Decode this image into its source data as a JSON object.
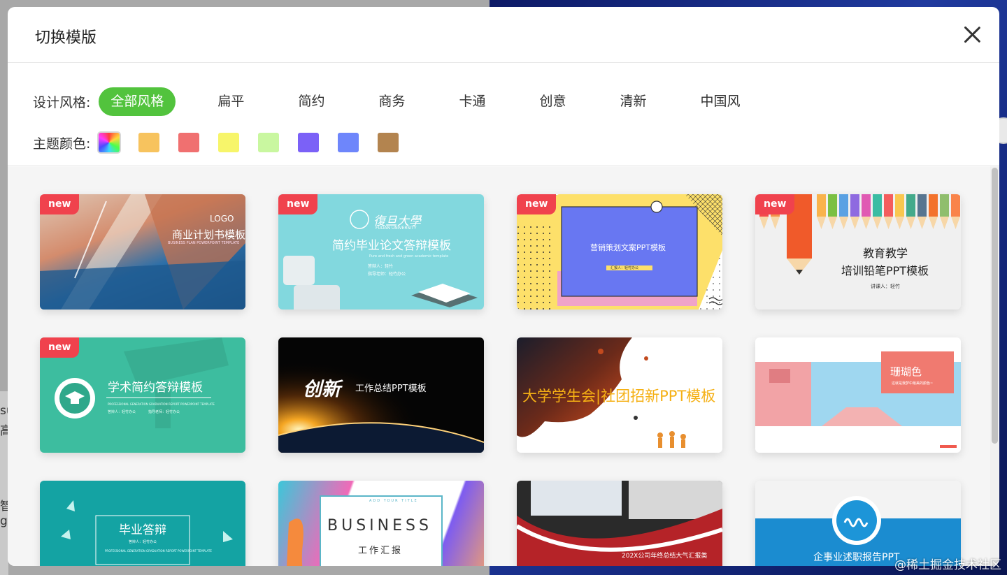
{
  "background": {
    "left_text": [
      "su",
      "高",
      "智",
      "ge"
    ]
  },
  "modal": {
    "title": "切换模版",
    "filters": {
      "style_label": "设计风格:",
      "styles": [
        "全部风格",
        "扁平",
        "简约",
        "商务",
        "卡通",
        "创意",
        "清新",
        "中国风"
      ],
      "active_style": "全部风格",
      "color_label": "主题颜色:",
      "colors": [
        "rainbow",
        "#f7c35e",
        "#f07070",
        "#f7f56a",
        "#c9f7a0",
        "#7b61f7",
        "#6e86fb",
        "#b3844f"
      ]
    },
    "templates": [
      {
        "title": "商业计划书模板",
        "subtitle": "BUSINESS PLAN POWERPOINT TEMPLATE",
        "logo": "LOGO",
        "badge": "new"
      },
      {
        "title": "简约毕业论文答辩模板",
        "school": "復旦大學",
        "school_en": "FUDAN UNIVERSITY",
        "subtitle": "Pure and fresh and green academic template",
        "meta1": "答辩人：轻竹",
        "meta2": "指导老师：轻竹办公",
        "badge": "new"
      },
      {
        "title": "营销策划文案PPT模板",
        "meta": "汇报人：轻竹办公",
        "badge": "new"
      },
      {
        "title": "教育教学",
        "title2": "培训铅笔PPT模板",
        "meta": "讲课人：轻竹",
        "badge": "new"
      },
      {
        "title": "学术简约答辩模板",
        "subtitle": "PROFESSIONAL GENERATION GRADUATION REPORT POWERPOINT TEMPLATE",
        "meta1": "答辩人：轻竹办公",
        "meta2": "指导老师：轻竹办公",
        "badge": "new"
      },
      {
        "title": "工作总结PPT模板",
        "art": "创新"
      },
      {
        "title": "大学学生会|社团招新PPT模板"
      },
      {
        "title": "珊瑚色",
        "subtitle": "这就是我梦中最美的颜色~"
      },
      {
        "title": "毕业答辩",
        "meta": "答辩人：轻竹办公",
        "subtitle": "PROFESSIONAL GENERATION GRADUATION REPORT POWERPOINT TEMPLATE"
      },
      {
        "title": "BUSINESS",
        "title2": "工作汇报",
        "subtitle": "ADD YOUR TITLE"
      },
      {
        "title": "202X公司年终总结大气汇报类"
      },
      {
        "title": "企事业述职报告PPT"
      }
    ]
  },
  "watermark": "@稀土掘金技术社区"
}
